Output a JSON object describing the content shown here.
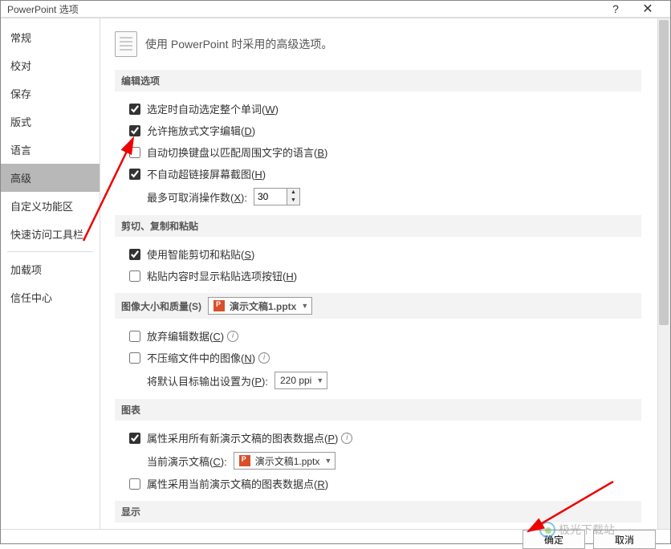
{
  "title": "PowerPoint 选项",
  "sidebar": {
    "items": [
      "常规",
      "校对",
      "保存",
      "版式",
      "语言",
      "高级",
      "自定义功能区",
      "快速访问工具栏",
      "加载项",
      "信任中心"
    ],
    "activeIndex": 5
  },
  "header": "使用 PowerPoint 时采用的高级选项。",
  "sections": {
    "edit": {
      "title": "编辑选项",
      "opt1": "选定时自动选定整个单词(",
      "opt1k": "W",
      "opt1e": ")",
      "opt2": "允许拖放式文字编辑(",
      "opt2k": "D",
      "opt2e": ")",
      "opt3": "自动切换键盘以匹配周围文字的语言(",
      "opt3k": "B",
      "opt3e": ")",
      "opt4": "不自动超链接屏幕截图(",
      "opt4k": "H",
      "opt4e": ")",
      "undoLabel": "最多可取消操作数(",
      "undoK": "X",
      "undoE": "):",
      "undoValue": "30"
    },
    "cut": {
      "title": "剪切、复制和粘贴",
      "opt1": "使用智能剪切和粘贴(",
      "opt1k": "S",
      "opt1e": ")",
      "opt2": "粘贴内容时显示粘贴选项按钮(",
      "opt2k": "H",
      "opt2e": ")"
    },
    "image": {
      "title": "图像大小和质量(",
      "titleK": "S",
      "titleE": ")",
      "file": "演示文稿1.pptx",
      "opt1": "放弃编辑数据(",
      "opt1k": "C",
      "opt1e": ")",
      "opt2": "不压缩文件中的图像(",
      "opt2k": "N",
      "opt2e": ")",
      "resLabel": "将默认目标输出设置为(",
      "resK": "P",
      "resE": "):",
      "resValue": "220 ppi"
    },
    "chart": {
      "title": "图表",
      "opt1": "属性采用所有新演示文稿的图表数据点(",
      "opt1k": "P",
      "opt1e": ")",
      "curLabel": "当前演示文稿(",
      "curK": "C",
      "curE": "):",
      "file": "演示文稿1.pptx",
      "opt2": "属性采用当前演示文稿的图表数据点(",
      "opt2k": "R",
      "opt2e": ")"
    },
    "display": {
      "title": "显示"
    }
  },
  "footer": {
    "ok": "确定",
    "cancel": "取消"
  },
  "watermark": "极光下载站"
}
